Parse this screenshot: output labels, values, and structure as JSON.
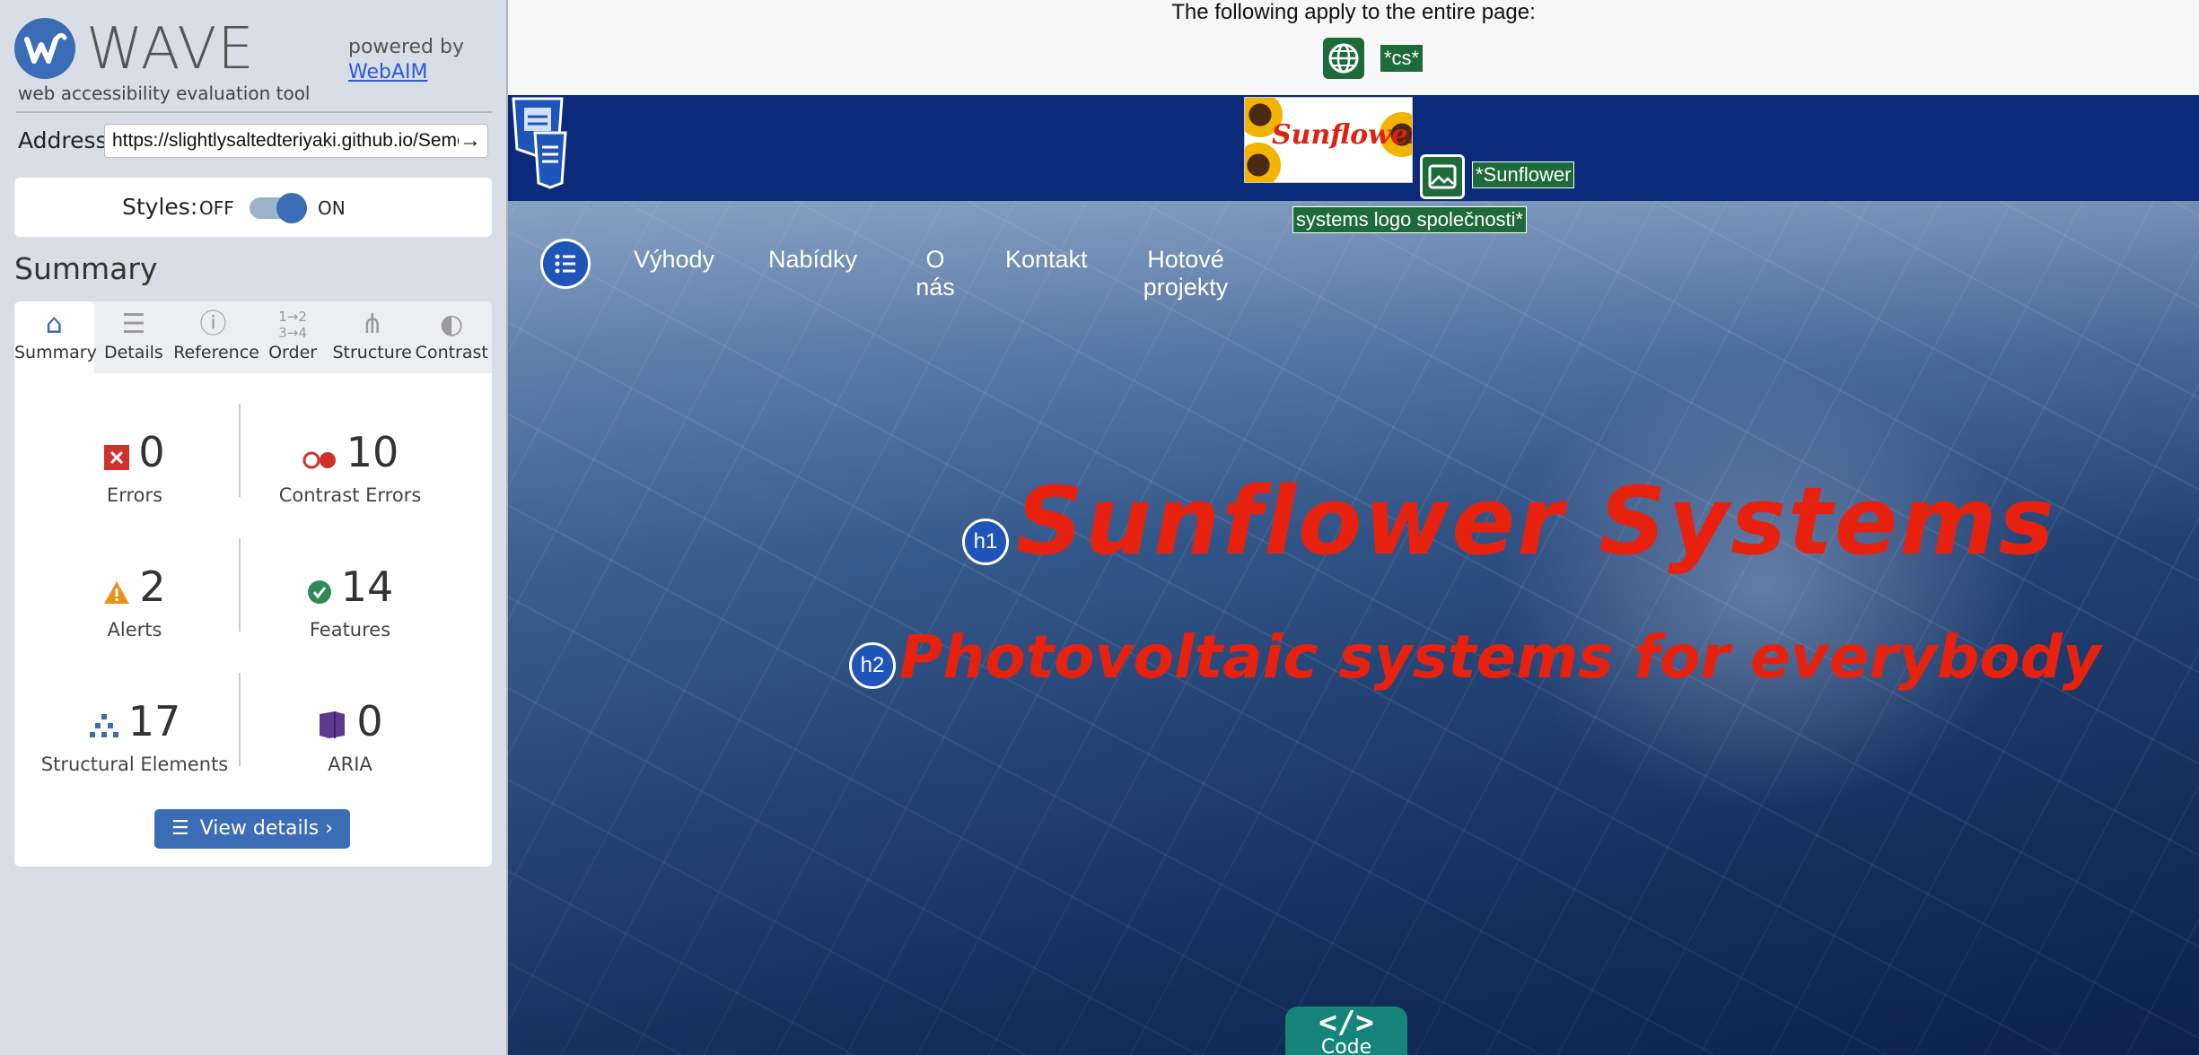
{
  "wave": {
    "title": "WAVE",
    "subtitle": "web accessibility evaluation tool",
    "powered_by": "powered by",
    "webaim_link": "WebAIM",
    "address_label": "Address:",
    "address_value": "https://slightlysaltedteriyaki.github.io/Seme",
    "styles_label": "Styles:",
    "styles_off": "OFF",
    "styles_on": "ON",
    "styles_state": "on",
    "summary_heading": "Summary",
    "tabs": [
      {
        "label": "Summary",
        "icon": "home-icon",
        "active": true
      },
      {
        "label": "Details",
        "icon": "list-icon",
        "active": false
      },
      {
        "label": "Reference",
        "icon": "info-icon",
        "active": false
      },
      {
        "label": "Order",
        "icon": "order-icon",
        "active": false
      },
      {
        "label": "Structure",
        "icon": "structure-icon",
        "active": false
      },
      {
        "label": "Contrast",
        "icon": "contrast-icon",
        "active": false
      }
    ],
    "stats": {
      "errors": {
        "count": "0",
        "label": "Errors",
        "color": "#d0312d"
      },
      "contrast_errors": {
        "count": "10",
        "label": "Contrast Errors",
        "color": "#d0312d"
      },
      "alerts": {
        "count": "2",
        "label": "Alerts",
        "color": "#e8941a"
      },
      "features": {
        "count": "14",
        "label": "Features",
        "color": "#2e8b57"
      },
      "structural": {
        "count": "17",
        "label": "Structural Elements",
        "color": "#3a6db5"
      },
      "aria": {
        "count": "0",
        "label": "ARIA",
        "color": "#5b3a8f"
      }
    },
    "view_details": "View details ›"
  },
  "page": {
    "apply_text": "The following apply to the entire page:",
    "lang_tag": "*cs*",
    "logo_text": "Sunflower",
    "logo_alt_line1": "*Sunflower",
    "logo_alt_line2": "systems logo společnosti*",
    "nav": [
      "Výhody",
      "Nabídky",
      "O nás",
      "Kontakt",
      "Hotové projekty"
    ],
    "h1_badge": "h1",
    "h1": "Sunflower Systems",
    "h2_badge": "h2",
    "h2": "Photovoltaic systems for everybody",
    "code_tab_icon": "</>",
    "code_tab_label": "Code"
  },
  "colors": {
    "wave_blue": "#3a6db5",
    "header_navy": "#0b2a7a",
    "wave_green": "#1d6b3a",
    "heading_red": "#e6220f"
  }
}
